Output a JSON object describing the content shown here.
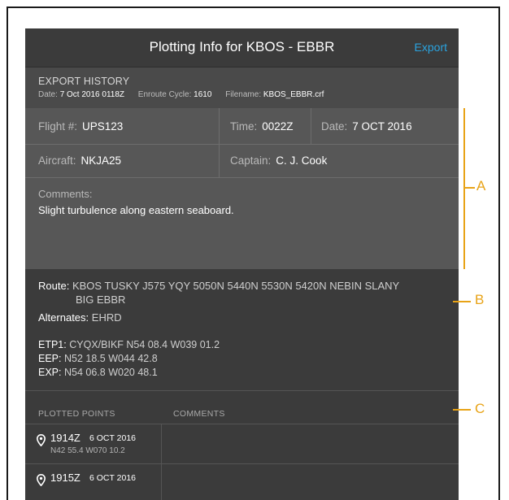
{
  "header": {
    "title": "Plotting Info for KBOS - EBBR",
    "export_label": "Export"
  },
  "export_history": {
    "heading": "EXPORT HISTORY",
    "date_label": "Date:",
    "date_value": "7 Oct 2016 0118Z",
    "cycle_label": "Enroute Cycle:",
    "cycle_value": "1610",
    "filename_label": "Filename:",
    "filename_value": "KBOS_EBBR.crf"
  },
  "form": {
    "flight_label": "Flight #:",
    "flight_value": "UPS123",
    "time_label": "Time:",
    "time_value": "0022Z",
    "date_label": "Date:",
    "date_value": "7 OCT 2016",
    "aircraft_label": "Aircraft:",
    "aircraft_value": "NKJA25",
    "captain_label": "Captain:",
    "captain_value": "C. J. Cook",
    "comments_label": "Comments:",
    "comments_value": "Slight turbulence along eastern seaboard."
  },
  "route": {
    "label": "Route:",
    "line1": "KBOS TUSKY J575 YQY 5050N 5440N 5530N 5420N NEBIN SLANY",
    "line2": "BIG EBBR",
    "alternates_label": "Alternates:",
    "alternates_value": "EHRD",
    "etp1_label": "ETP1:",
    "etp1_value": "CYQX/BIKF N54 08.4 W039 01.2",
    "eep_label": "EEP:",
    "eep_value": "N52 18.5 W044 42.8",
    "exp_label": "EXP:",
    "exp_value": "N54 06.8 W020 48.1"
  },
  "points_header": {
    "plotted": "PLOTTED POINTS",
    "comments": "COMMENTS"
  },
  "points": [
    {
      "time": "1914Z",
      "date": "6 OCT 2016",
      "coord": "N42 55.4 W070 10.2"
    },
    {
      "time": "1915Z",
      "date": "6 OCT 2016",
      "coord": ""
    }
  ],
  "callouts": {
    "a": "A",
    "b": "B",
    "c": "C"
  },
  "colors": {
    "accent": "#2aa3df",
    "callout": "#e8a317",
    "panel": "#3b3b3b",
    "form": "#575757"
  },
  "icons": {
    "point": "map-pin-icon"
  }
}
